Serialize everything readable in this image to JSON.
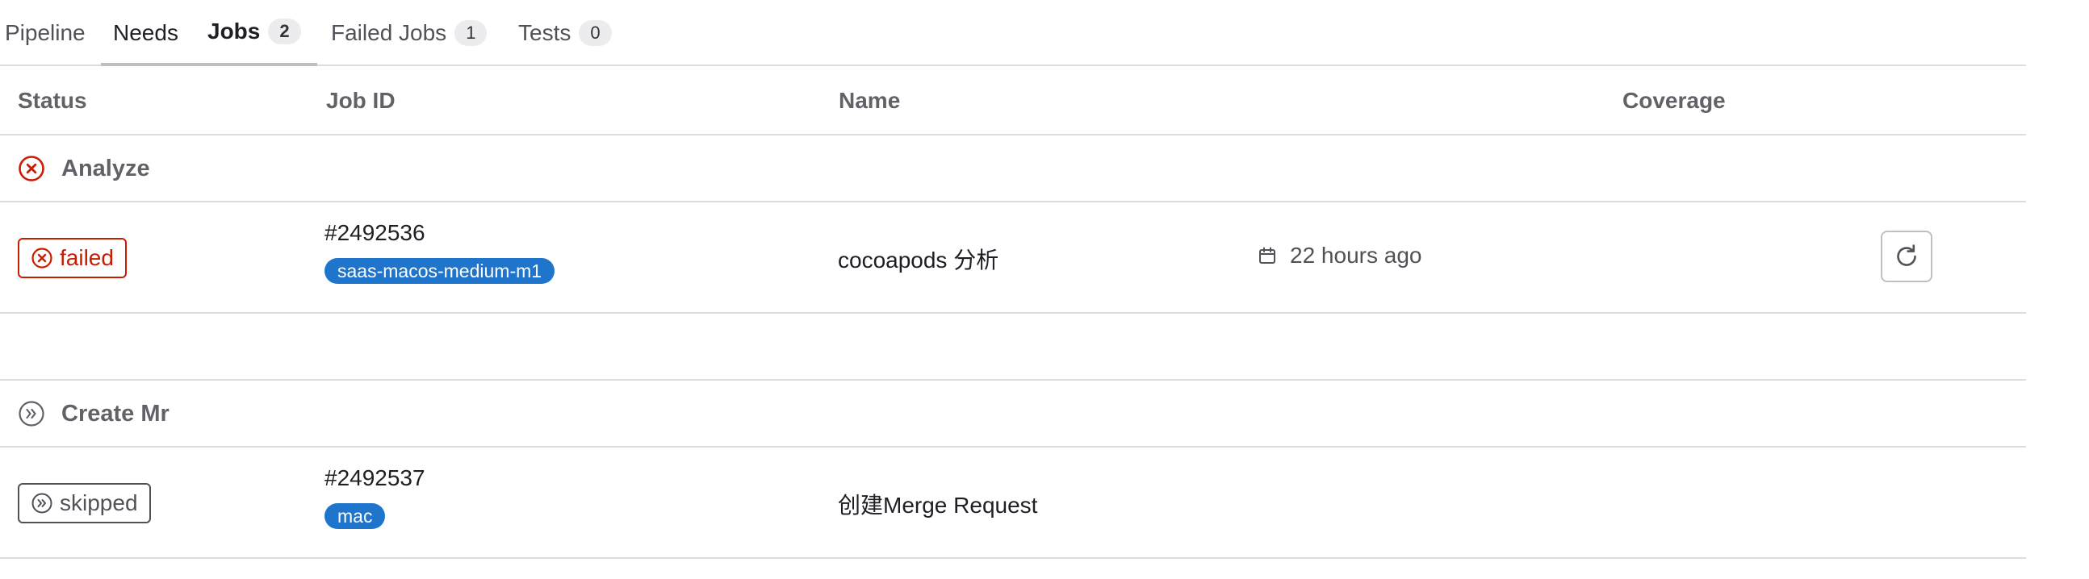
{
  "tabs": [
    {
      "label": "Pipeline"
    },
    {
      "label": "Needs"
    },
    {
      "label": "Jobs",
      "count": "2"
    },
    {
      "label": "Failed Jobs",
      "count": "1"
    },
    {
      "label": "Tests",
      "count": "0"
    }
  ],
  "table": {
    "headers": {
      "status": "Status",
      "job_id": "Job ID",
      "name": "Name",
      "coverage": "Coverage"
    },
    "groups": [
      {
        "title": "Analyze",
        "icon": "status-failed-icon",
        "jobs": [
          {
            "status": "failed",
            "job_id": "#2492536",
            "runner_tag": "saas-macos-medium-m1",
            "name": "cocoapods 分析",
            "finished": "22 hours ago",
            "action": "retry-icon"
          }
        ]
      },
      {
        "title": "Create Mr",
        "icon": "status-skipped-icon",
        "jobs": [
          {
            "status": "skipped",
            "job_id": "#2492537",
            "runner_tag": "mac",
            "name": "创建Merge Request"
          }
        ]
      }
    ]
  },
  "colors": {
    "failed": "#c91c00",
    "skipped": "#535158",
    "tag_blue": "#1f75cb",
    "border": "#dcdcde"
  }
}
